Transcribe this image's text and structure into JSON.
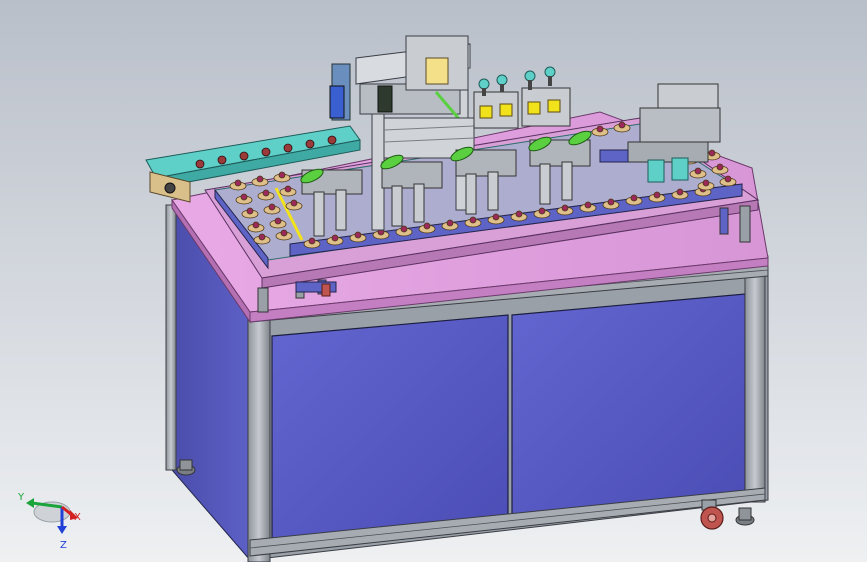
{
  "viewport": {
    "background_top": "#b9bfc9",
    "background_bottom": "#eef0f2"
  },
  "model": {
    "cabinet_panel_color": "#5658c2",
    "tabletop_color": "#d99ad9",
    "frame_color": "#9fa4ab",
    "conveyor_color": "#5fd0c8",
    "fixture_color": "#e0c08a",
    "accent_yellow": "#f2e21c",
    "caster_color": "#c0554f"
  },
  "triad": {
    "x_label": "X",
    "y_label": "Y",
    "z_label": "Z",
    "x_color": "#d22020",
    "y_color": "#1aa43a",
    "z_color": "#2040d8"
  }
}
